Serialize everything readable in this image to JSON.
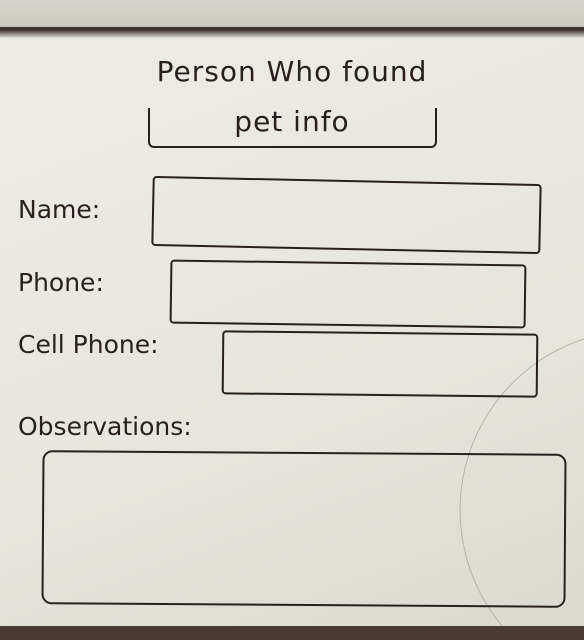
{
  "form": {
    "title_line1": "Person Who found",
    "title_line2": "pet info",
    "fields": [
      {
        "label": "Name:",
        "value": ""
      },
      {
        "label": "Phone:",
        "value": ""
      },
      {
        "label": "Cell Phone:",
        "value": ""
      }
    ],
    "observations_label": "Observations:",
    "observations_value": ""
  }
}
